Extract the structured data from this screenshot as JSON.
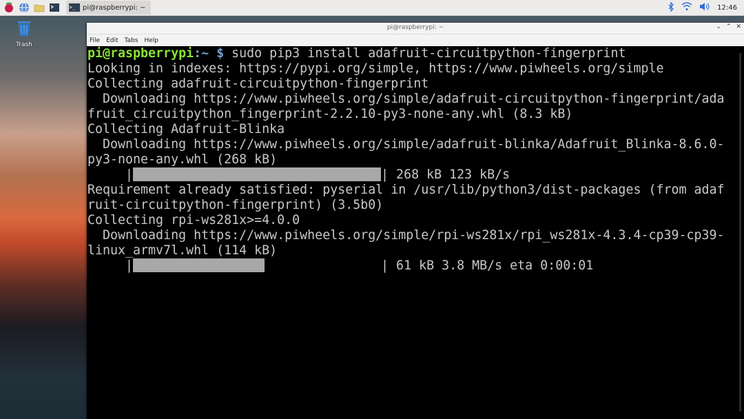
{
  "taskbar": {
    "task_title": "pi@raspberrypi: ~",
    "task_icon_text": ">_",
    "clock": "12:46"
  },
  "desktop": {
    "trash_label": "Trash"
  },
  "window": {
    "title": "pi@raspberrypi: ~",
    "menu": [
      "File",
      "Edit",
      "Tabs",
      "Help"
    ]
  },
  "terminal": {
    "prompt_user": "pi@raspberrypi",
    "prompt_dir": ":~",
    "prompt_symbol": " $",
    "command": " sudo pip3 install adafruit-circuitpython-fingerprint",
    "lines": [
      "Looking in indexes: https://pypi.org/simple, https://www.piwheels.org/simple",
      "Collecting adafruit-circuitpython-fingerprint",
      "  Downloading https://www.piwheels.org/simple/adafruit-circuitpython-fingerprint/ada",
      "fruit_circuitpython_fingerprint-2.2.10-py3-none-any.whl (8.3 kB)",
      "Collecting Adafruit-Blinka",
      "  Downloading https://www.piwheels.org/simple/adafruit-blinka/Adafruit_Blinka-8.6.0-",
      "py3-none-any.whl (268 kB)"
    ],
    "progress1": {
      "prefix": "     |",
      "suffix": "| 268 kB 123 kB/s",
      "fraction": 1.0
    },
    "lines2": [
      "Requirement already satisfied: pyserial in /usr/lib/python3/dist-packages (from adaf",
      "ruit-circuitpython-fingerprint) (3.5b0)",
      "Collecting rpi-ws281x>=4.0.0",
      "  Downloading https://www.piwheels.org/simple/rpi-ws281x/rpi_ws281x-4.3.4-cp39-cp39-",
      "linux_armv7l.whl (114 kB)"
    ],
    "progress2": {
      "prefix": "     |",
      "suffix": "| 61 kB 3.8 MB/s eta 0:00:01",
      "fraction": 0.53
    }
  }
}
